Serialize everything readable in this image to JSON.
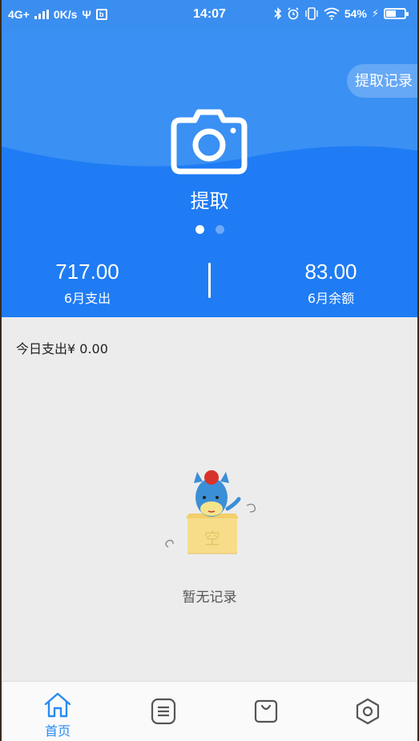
{
  "status_bar": {
    "network": "4G+",
    "speed": "0K/s",
    "usb_badge": "b",
    "time": "14:07",
    "battery": "54%",
    "battery_fraction": 0.54
  },
  "header": {
    "record_button": "提取记录",
    "action_label": "提取",
    "carousel": {
      "pages": 2,
      "active": 0
    }
  },
  "stats": {
    "expense": {
      "value": "717.00",
      "label": "6月支出"
    },
    "balance": {
      "value": "83.00",
      "label": "6月余额"
    }
  },
  "today": {
    "label": "今日支出",
    "amount": "¥ 0.00"
  },
  "empty": {
    "box_char": "空",
    "text": "暂无记录"
  },
  "bottom_nav": {
    "items": [
      {
        "icon": "home-icon",
        "label": "首页",
        "active": true
      },
      {
        "icon": "list-icon",
        "label": "",
        "active": false
      },
      {
        "icon": "bag-icon",
        "label": "",
        "active": false
      },
      {
        "icon": "settings-hexagon-icon",
        "label": "",
        "active": false
      }
    ]
  },
  "colors": {
    "primary": "#1f7cf4",
    "status_bar": "#3a8ef0",
    "active_nav": "#2a8af3",
    "inactive_nav": "#555555",
    "background": "#ececec"
  }
}
